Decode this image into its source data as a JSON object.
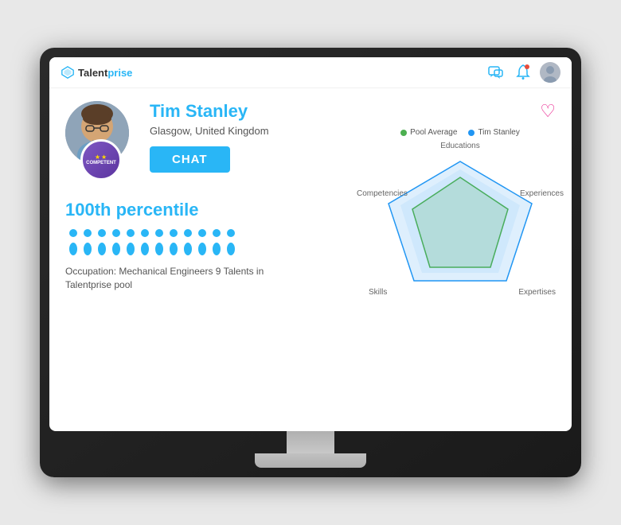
{
  "app": {
    "logo_talent": "Talent",
    "logo_prise": "prise"
  },
  "header": {
    "heart_icon": "♡",
    "chat_icon": "💬",
    "bell_icon": "🔔"
  },
  "profile": {
    "name": "Tim Stanley",
    "location": "Glasgow, United Kingdom",
    "chat_button": "CHAT",
    "badge_label": "COMPETENT",
    "badge_stars": "★★"
  },
  "radar": {
    "legend_pool": "Pool Average",
    "legend_candidate": "Tim Stanley",
    "labels": {
      "top": "Educations",
      "left": "Competencies",
      "right": "Experiences",
      "bottom_left": "Skills",
      "bottom_right": "Expertises"
    }
  },
  "stats": {
    "percentile": "100th percentile",
    "people_count": 12,
    "occupation_text": "Occupation: Mechanical Engineers 9 Talents\nin Talentprise pool"
  }
}
